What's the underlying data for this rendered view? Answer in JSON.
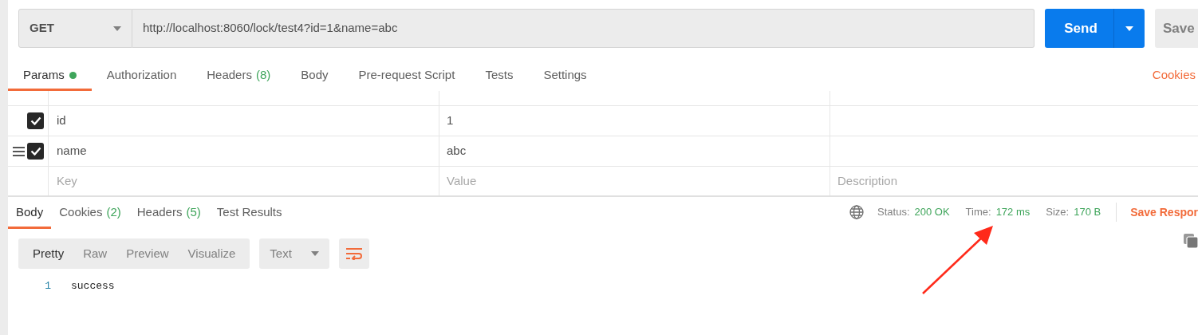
{
  "request": {
    "method": "GET",
    "url": "http://localhost:8060/lock/test4?id=1&name=abc",
    "send": "Send",
    "save": "Save"
  },
  "request_tabs": [
    {
      "label": "Params",
      "indicator": true,
      "selected": true
    },
    {
      "label": "Authorization",
      "indicator": false,
      "selected": false
    },
    {
      "label": "Headers",
      "count": "(8)",
      "indicator": false,
      "selected": false
    },
    {
      "label": "Body",
      "indicator": false,
      "selected": false
    },
    {
      "label": "Pre-request Script",
      "indicator": false,
      "selected": false
    },
    {
      "label": "Tests",
      "indicator": false,
      "selected": false
    },
    {
      "label": "Settings",
      "indicator": false,
      "selected": false
    }
  ],
  "cookies_link": "Cookies",
  "params": [
    {
      "key": "id",
      "value": "1",
      "checked": true,
      "drag_handle": false
    },
    {
      "key": "name",
      "value": "abc",
      "checked": true,
      "drag_handle": true
    }
  ],
  "new_param": {
    "key_placeholder": "Key",
    "value_placeholder": "Value",
    "description_placeholder": "Description"
  },
  "response_tabs": [
    {
      "label": "Body",
      "selected": true
    },
    {
      "label": "Cookies",
      "count": "(2)",
      "selected": false
    },
    {
      "label": "Headers",
      "count": "(5)",
      "selected": false
    },
    {
      "label": "Test Results",
      "selected": false
    }
  ],
  "response_meta": [
    {
      "label": "Status:",
      "value": "200 OK"
    },
    {
      "label": "Time:",
      "value": "172 ms"
    },
    {
      "label": "Size:",
      "value": "170 B"
    }
  ],
  "save_response": "Save Respor",
  "view_modes": [
    {
      "label": "Pretty",
      "selected": true
    },
    {
      "label": "Raw",
      "selected": false
    },
    {
      "label": "Preview",
      "selected": false
    },
    {
      "label": "Visualize",
      "selected": false
    }
  ],
  "format": "Text",
  "code_lines": [
    {
      "number": "1",
      "text": "success"
    }
  ]
}
